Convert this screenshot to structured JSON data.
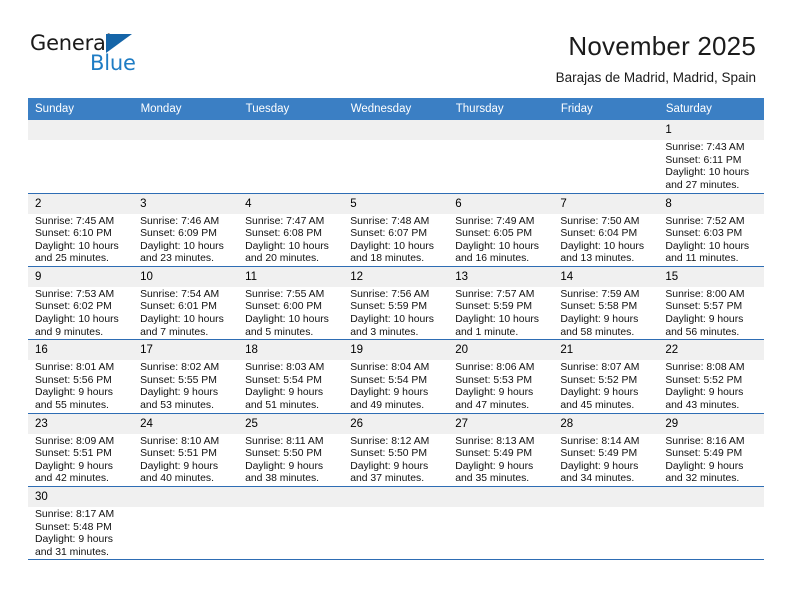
{
  "brand": {
    "name_top": "General",
    "name_bottom": "Blue",
    "triangle_color": "#1565a8",
    "blue_color": "#1e7cc4"
  },
  "header": {
    "title": "November 2025",
    "subtitle": "Barajas de Madrid, Madrid, Spain",
    "header_bg": "#3b7fc4",
    "row_border": "#2e6db4",
    "daynum_bg": "#f0f0f0"
  },
  "weekday_headers": [
    "Sunday",
    "Monday",
    "Tuesday",
    "Wednesday",
    "Thursday",
    "Friday",
    "Saturday"
  ],
  "weeks": [
    [
      {
        "day": "",
        "blank": true
      },
      {
        "day": "",
        "blank": true
      },
      {
        "day": "",
        "blank": true
      },
      {
        "day": "",
        "blank": true
      },
      {
        "day": "",
        "blank": true
      },
      {
        "day": "",
        "blank": true
      },
      {
        "day": "1",
        "sunrise": "Sunrise: 7:43 AM",
        "sunset": "Sunset: 6:11 PM",
        "daylight1": "Daylight: 10 hours",
        "daylight2": "and 27 minutes."
      }
    ],
    [
      {
        "day": "2",
        "sunrise": "Sunrise: 7:45 AM",
        "sunset": "Sunset: 6:10 PM",
        "daylight1": "Daylight: 10 hours",
        "daylight2": "and 25 minutes."
      },
      {
        "day": "3",
        "sunrise": "Sunrise: 7:46 AM",
        "sunset": "Sunset: 6:09 PM",
        "daylight1": "Daylight: 10 hours",
        "daylight2": "and 23 minutes."
      },
      {
        "day": "4",
        "sunrise": "Sunrise: 7:47 AM",
        "sunset": "Sunset: 6:08 PM",
        "daylight1": "Daylight: 10 hours",
        "daylight2": "and 20 minutes."
      },
      {
        "day": "5",
        "sunrise": "Sunrise: 7:48 AM",
        "sunset": "Sunset: 6:07 PM",
        "daylight1": "Daylight: 10 hours",
        "daylight2": "and 18 minutes."
      },
      {
        "day": "6",
        "sunrise": "Sunrise: 7:49 AM",
        "sunset": "Sunset: 6:05 PM",
        "daylight1": "Daylight: 10 hours",
        "daylight2": "and 16 minutes."
      },
      {
        "day": "7",
        "sunrise": "Sunrise: 7:50 AM",
        "sunset": "Sunset: 6:04 PM",
        "daylight1": "Daylight: 10 hours",
        "daylight2": "and 13 minutes."
      },
      {
        "day": "8",
        "sunrise": "Sunrise: 7:52 AM",
        "sunset": "Sunset: 6:03 PM",
        "daylight1": "Daylight: 10 hours",
        "daylight2": "and 11 minutes."
      }
    ],
    [
      {
        "day": "9",
        "sunrise": "Sunrise: 7:53 AM",
        "sunset": "Sunset: 6:02 PM",
        "daylight1": "Daylight: 10 hours",
        "daylight2": "and 9 minutes."
      },
      {
        "day": "10",
        "sunrise": "Sunrise: 7:54 AM",
        "sunset": "Sunset: 6:01 PM",
        "daylight1": "Daylight: 10 hours",
        "daylight2": "and 7 minutes."
      },
      {
        "day": "11",
        "sunrise": "Sunrise: 7:55 AM",
        "sunset": "Sunset: 6:00 PM",
        "daylight1": "Daylight: 10 hours",
        "daylight2": "and 5 minutes."
      },
      {
        "day": "12",
        "sunrise": "Sunrise: 7:56 AM",
        "sunset": "Sunset: 5:59 PM",
        "daylight1": "Daylight: 10 hours",
        "daylight2": "and 3 minutes."
      },
      {
        "day": "13",
        "sunrise": "Sunrise: 7:57 AM",
        "sunset": "Sunset: 5:59 PM",
        "daylight1": "Daylight: 10 hours",
        "daylight2": "and 1 minute."
      },
      {
        "day": "14",
        "sunrise": "Sunrise: 7:59 AM",
        "sunset": "Sunset: 5:58 PM",
        "daylight1": "Daylight: 9 hours",
        "daylight2": "and 58 minutes."
      },
      {
        "day": "15",
        "sunrise": "Sunrise: 8:00 AM",
        "sunset": "Sunset: 5:57 PM",
        "daylight1": "Daylight: 9 hours",
        "daylight2": "and 56 minutes."
      }
    ],
    [
      {
        "day": "16",
        "sunrise": "Sunrise: 8:01 AM",
        "sunset": "Sunset: 5:56 PM",
        "daylight1": "Daylight: 9 hours",
        "daylight2": "and 55 minutes."
      },
      {
        "day": "17",
        "sunrise": "Sunrise: 8:02 AM",
        "sunset": "Sunset: 5:55 PM",
        "daylight1": "Daylight: 9 hours",
        "daylight2": "and 53 minutes."
      },
      {
        "day": "18",
        "sunrise": "Sunrise: 8:03 AM",
        "sunset": "Sunset: 5:54 PM",
        "daylight1": "Daylight: 9 hours",
        "daylight2": "and 51 minutes."
      },
      {
        "day": "19",
        "sunrise": "Sunrise: 8:04 AM",
        "sunset": "Sunset: 5:54 PM",
        "daylight1": "Daylight: 9 hours",
        "daylight2": "and 49 minutes."
      },
      {
        "day": "20",
        "sunrise": "Sunrise: 8:06 AM",
        "sunset": "Sunset: 5:53 PM",
        "daylight1": "Daylight: 9 hours",
        "daylight2": "and 47 minutes."
      },
      {
        "day": "21",
        "sunrise": "Sunrise: 8:07 AM",
        "sunset": "Sunset: 5:52 PM",
        "daylight1": "Daylight: 9 hours",
        "daylight2": "and 45 minutes."
      },
      {
        "day": "22",
        "sunrise": "Sunrise: 8:08 AM",
        "sunset": "Sunset: 5:52 PM",
        "daylight1": "Daylight: 9 hours",
        "daylight2": "and 43 minutes."
      }
    ],
    [
      {
        "day": "23",
        "sunrise": "Sunrise: 8:09 AM",
        "sunset": "Sunset: 5:51 PM",
        "daylight1": "Daylight: 9 hours",
        "daylight2": "and 42 minutes."
      },
      {
        "day": "24",
        "sunrise": "Sunrise: 8:10 AM",
        "sunset": "Sunset: 5:51 PM",
        "daylight1": "Daylight: 9 hours",
        "daylight2": "and 40 minutes."
      },
      {
        "day": "25",
        "sunrise": "Sunrise: 8:11 AM",
        "sunset": "Sunset: 5:50 PM",
        "daylight1": "Daylight: 9 hours",
        "daylight2": "and 38 minutes."
      },
      {
        "day": "26",
        "sunrise": "Sunrise: 8:12 AM",
        "sunset": "Sunset: 5:50 PM",
        "daylight1": "Daylight: 9 hours",
        "daylight2": "and 37 minutes."
      },
      {
        "day": "27",
        "sunrise": "Sunrise: 8:13 AM",
        "sunset": "Sunset: 5:49 PM",
        "daylight1": "Daylight: 9 hours",
        "daylight2": "and 35 minutes."
      },
      {
        "day": "28",
        "sunrise": "Sunrise: 8:14 AM",
        "sunset": "Sunset: 5:49 PM",
        "daylight1": "Daylight: 9 hours",
        "daylight2": "and 34 minutes."
      },
      {
        "day": "29",
        "sunrise": "Sunrise: 8:16 AM",
        "sunset": "Sunset: 5:49 PM",
        "daylight1": "Daylight: 9 hours",
        "daylight2": "and 32 minutes."
      }
    ],
    [
      {
        "day": "30",
        "sunrise": "Sunrise: 8:17 AM",
        "sunset": "Sunset: 5:48 PM",
        "daylight1": "Daylight: 9 hours",
        "daylight2": "and 31 minutes."
      },
      {
        "day": "",
        "blank": true
      },
      {
        "day": "",
        "blank": true
      },
      {
        "day": "",
        "blank": true
      },
      {
        "day": "",
        "blank": true
      },
      {
        "day": "",
        "blank": true
      },
      {
        "day": "",
        "blank": true
      }
    ]
  ]
}
